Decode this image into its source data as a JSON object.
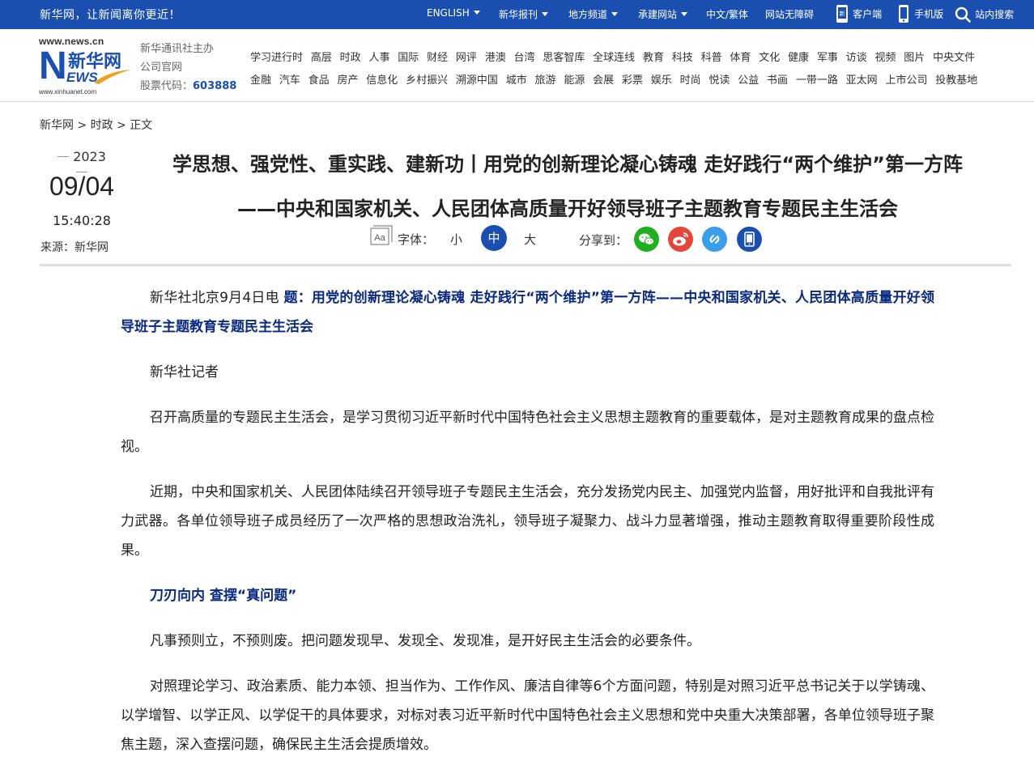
{
  "topbar": {
    "slogan": "新华网，让新闻离你更近！",
    "nav": [
      {
        "label": "ENGLISH",
        "dropdown": true
      },
      {
        "label": "新华报刊",
        "dropdown": true
      },
      {
        "label": "地方频道",
        "dropdown": true
      },
      {
        "label": "承建网站",
        "dropdown": true
      },
      {
        "label": "中文/繁体",
        "dropdown": false
      },
      {
        "label": "网站无障碍",
        "dropdown": false
      }
    ],
    "client_label": "客户端",
    "mobile_label": "手机版",
    "search_label": "站内搜索"
  },
  "header": {
    "logo_url": "www.news.cn",
    "logo_n": "N",
    "logo_cn": "新华网",
    "logo_ews": "EWS",
    "logo_url2": "www.xinhuanet.com",
    "org_line1": "新华通讯社主办",
    "org_line2": "公司官网",
    "stock_label": "股票代码：",
    "stock_code": "603888",
    "nav_row1": [
      "学习进行时",
      "高层",
      "时政",
      "人事",
      "国际",
      "财经",
      "网评",
      "港澳",
      "台湾",
      "思客智库",
      "全球连线",
      "教育",
      "科技",
      "科普",
      "体育",
      "文化",
      "健康",
      "军事",
      "访谈",
      "视频",
      "图片",
      "中央文件"
    ],
    "nav_row2": [
      "金融",
      "汽车",
      "食品",
      "房产",
      "信息化",
      "乡村振兴",
      "溯源中国",
      "城市",
      "旅游",
      "能源",
      "会展",
      "彩票",
      "娱乐",
      "时尚",
      "悦读",
      "公益",
      "书画",
      "一带一路",
      "亚太网",
      "上市公司",
      "投教基地"
    ]
  },
  "breadcrumb": {
    "home": "新华网",
    "sep": ">",
    "section": "时政",
    "current": "正文"
  },
  "meta": {
    "year": "2023",
    "month_day": "09/04",
    "time": "15:40:28",
    "source": "来源：新华网"
  },
  "title": "学思想、强党性、重实践、建新功丨用党的创新理论凝心铸魂 走好践行“两个维护”第一方阵——中央和国家机关、人民团体高质量开好领导班子主题教育专题民主生活会",
  "font_size": {
    "label": "字体：",
    "small": "小",
    "medium": "中",
    "large": "大",
    "selected": "medium"
  },
  "share": {
    "label": "分享到：",
    "targets": [
      {
        "name": "wechat",
        "color": "#1fb01f"
      },
      {
        "name": "weibo",
        "color": "#e6453a"
      },
      {
        "name": "link",
        "color": "#3a9ee8"
      },
      {
        "name": "mobile",
        "color": "#1a4faf"
      }
    ]
  },
  "article": {
    "dateline": "新华社北京9月4日电 ",
    "lead_title": "题：用党的创新理论凝心铸魂 走好践行“两个维护”第一方阵——中央和国家机关、人民团体高质量开好领导班子主题教育专题民主生活会",
    "byline": "新华社记者",
    "p1": "召开高质量的专题民主生活会，是学习贯彻习近平新时代中国特色社会主义思想主题教育的重要载体，是对主题教育成果的盘点检视。",
    "p2": "近期，中央和国家机关、人民团体陆续召开领导班子专题民主生活会，充分发扬党内民主、加强党内监督，用好批评和自我批评有力武器。各单位领导班子成员经历了一次严格的思想政治洗礼，领导班子凝聚力、战斗力显著增强，推动主题教育取得重要阶段性成果。",
    "subhead": "刀刃向内 查摆“真问题”",
    "p3": "凡事预则立，不预则废。把问题发现早、发现全、发现准，是开好民主生活会的必要条件。",
    "p4": "对照理论学习、政治素质、能力本领、担当作为、工作作风、廉洁自律等6个方面问题，特别是对照习近平总书记关于以学铸魂、以学增智、以学正风、以学促干的具体要求，对标对表习近平新时代中国特色社会主义思想和党中央重大决策部署，各单位领导班子聚焦主题，深入查摆问题，确保民主生活会提质增效。"
  }
}
